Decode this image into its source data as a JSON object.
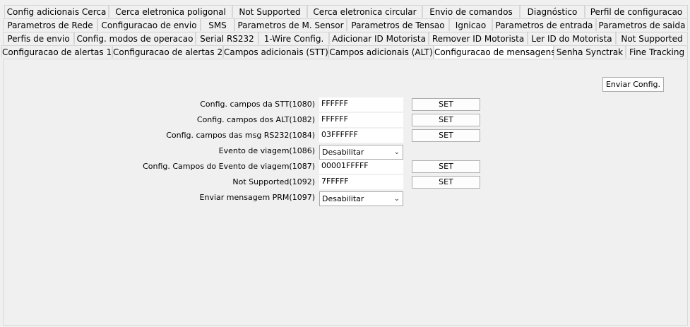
{
  "tabs": {
    "row1": [
      "Config adicionais Cerca",
      "Cerca eletronica poligonal",
      "Not Supported",
      "Cerca eletronica circular",
      "Envio de comandos",
      "Diagnóstico",
      "Perfil de configuracao"
    ],
    "row2": [
      "Parametros de Rede",
      "Configuracao de envio",
      "SMS",
      "Parametros de M. Sensor",
      "Parametros de Tensao",
      "Ignicao",
      "Parametros de entrada",
      "Parametros de saida"
    ],
    "row3": [
      "Perfis de envio",
      "Config. modos de operacao",
      "Serial RS232",
      "1-Wire Config.",
      "Adicionar ID Motorista",
      "Remover ID Motorista",
      "Ler ID do Motorista",
      "Not Supported"
    ],
    "row4": [
      "Configuracao de alertas 1",
      "Configuracao de alertas 2",
      "Campos adicionais (STT)",
      "Campos adicionais (ALT)",
      "Configuracao de mensagens",
      "Senha Synctrak",
      "Fine Tracking"
    ],
    "active": "Configuracao de mensagens"
  },
  "panel": {
    "send_button": "Enviar Config.",
    "rows": [
      {
        "label": "Config. campos da STT(1080)",
        "value": "FFFFFF",
        "button": "SET"
      },
      {
        "label": "Config. campos dos ALT(1082)",
        "value": "FFFFFF",
        "button": "SET"
      },
      {
        "label": "Config. campos das msg RS232(1084)",
        "value": "03FFFFFF",
        "button": "SET"
      },
      {
        "label": "Evento de viagem(1086)",
        "select": "Desabilitar"
      },
      {
        "label": "Config. Campos do Evento de viagem(1087)",
        "value": "00001FFFFF",
        "button": "SET"
      },
      {
        "label": "Not Supported(1092)",
        "value": "7FFFFF",
        "button": "SET"
      },
      {
        "label": "Enviar mensagem PRM(1097)",
        "select": "Desabilitar"
      }
    ]
  }
}
